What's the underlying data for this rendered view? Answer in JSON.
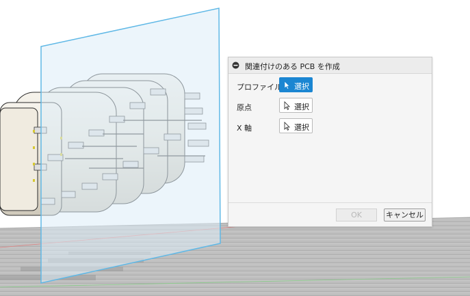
{
  "dialog": {
    "title": "関連付けのある PCB を作成",
    "rows": [
      {
        "label": "プロファイル",
        "button": "選択",
        "active": true
      },
      {
        "label": "原点",
        "button": "選択",
        "active": false
      },
      {
        "label": "X 軸",
        "button": "選択",
        "active": false
      }
    ],
    "ok_label": "OK",
    "cancel_label": "キャンセル"
  },
  "colors": {
    "active_button": "#1b86d2",
    "sketch_plane_edge": "#5fb8e6",
    "sketch_plane_fill": "#dcedf8"
  },
  "icons": [
    "collapse-icon",
    "cursor-icon"
  ]
}
